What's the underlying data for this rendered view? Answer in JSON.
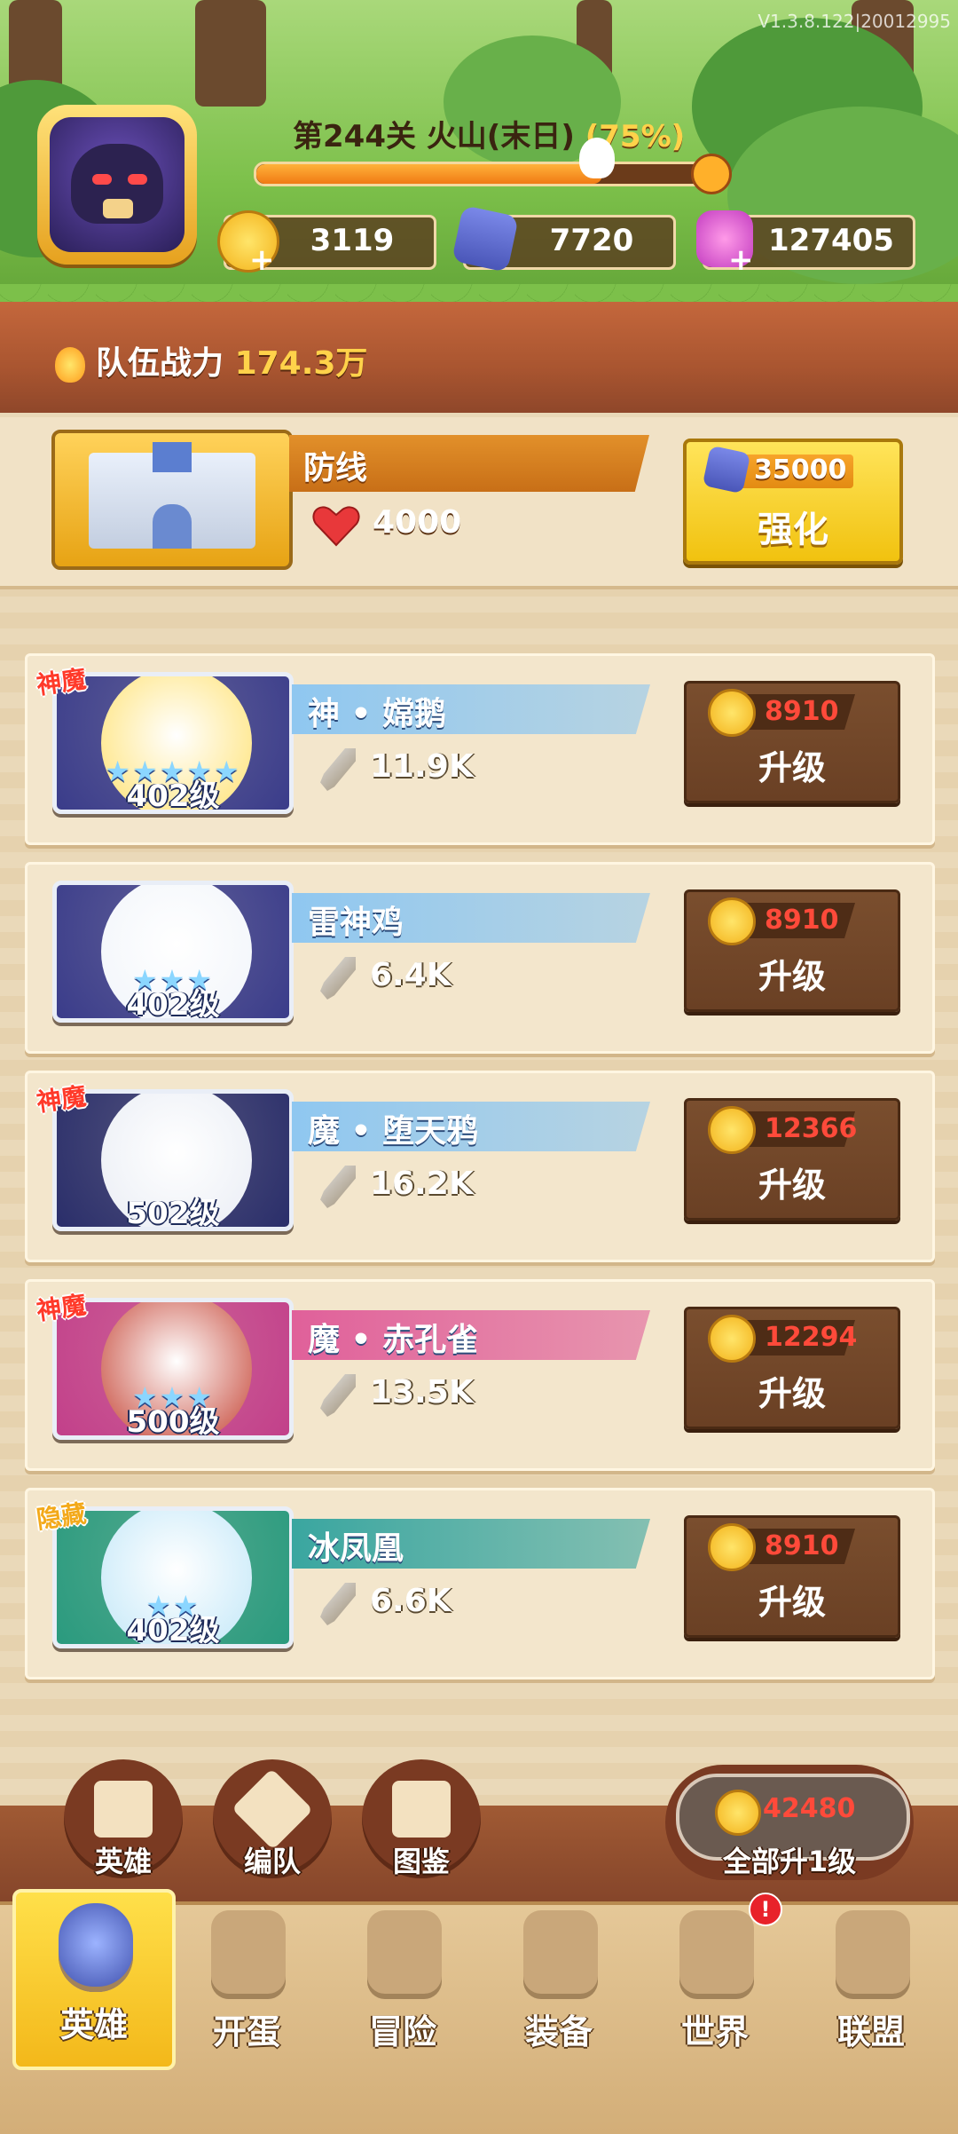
{
  "version": "V1.3.8.122|20012995",
  "stage": {
    "title": "第244关 火山(末日)",
    "percent_text": "(75%)",
    "progress": 0.75
  },
  "resources": {
    "gold": "3119",
    "rune": "7720",
    "gems": "127405"
  },
  "team_power": {
    "label": "队伍战力",
    "value": "174.3万"
  },
  "defense": {
    "name": "防线",
    "hp": "4000",
    "enhance_cost": "35000",
    "enhance_label": "强化"
  },
  "heroes": [
    {
      "tag": "神魔",
      "name": "神 • 嫦鹅",
      "power": "11.9K",
      "level": "402级",
      "stars": "★★★★★",
      "cost": "8910",
      "button": "升级",
      "bar_color": "#8fc7f0",
      "frame_color": "#3a3c8a"
    },
    {
      "tag": "",
      "name": "雷神鸡",
      "power": "6.4K",
      "level": "402级",
      "stars": "★★★",
      "cost": "8910",
      "button": "升级",
      "bar_color": "#8fc7f0",
      "frame_color": "#3a3c8a"
    },
    {
      "tag": "神魔",
      "name": "魔 • 堕天鸦",
      "power": "16.2K",
      "level": "502级",
      "stars": "",
      "cost": "12366",
      "button": "升级",
      "bar_color": "#8fc7f0",
      "frame_color": "#2a2e6a"
    },
    {
      "tag": "神魔",
      "name": "魔 • 赤孔雀",
      "power": "13.5K",
      "level": "500级",
      "stars": "★★★",
      "cost": "12294",
      "button": "升级",
      "bar_color": "#e0609a",
      "frame_color": "#c2408a"
    },
    {
      "tag": "隐藏",
      "name": "冰凤凰",
      "power": "6.6K",
      "level": "402级",
      "stars": "★★",
      "cost": "8910",
      "button": "升级",
      "bar_color": "#3aa6a0",
      "frame_color": "#2a9a7e"
    }
  ],
  "tools": [
    {
      "label": "英雄"
    },
    {
      "label": "编队"
    },
    {
      "label": "图鉴"
    }
  ],
  "all_upgrade": {
    "cost": "42480",
    "label": "全部升1级"
  },
  "nav": [
    {
      "label": "英雄",
      "active": true
    },
    {
      "label": "开蛋"
    },
    {
      "label": "冒险"
    },
    {
      "label": "装备"
    },
    {
      "label": "世界",
      "badge": "!"
    },
    {
      "label": "联盟"
    }
  ]
}
